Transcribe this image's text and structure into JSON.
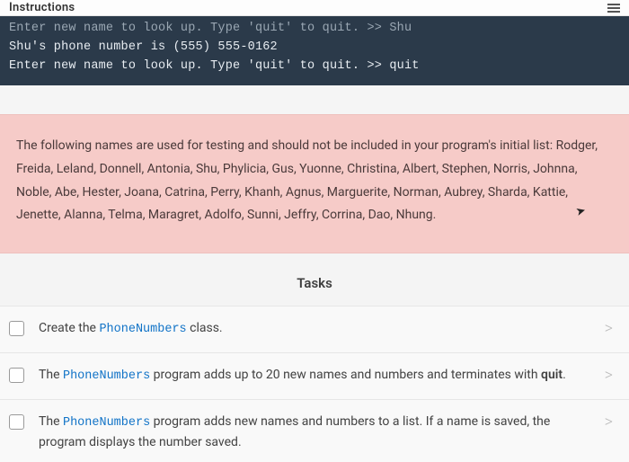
{
  "header": {
    "title_partial": "Instructions"
  },
  "terminal": {
    "line1_dim": "Enter new name to look up. Type 'quit' to quit. >> Shu",
    "line2": "Shu's phone number is (555) 555-0162",
    "line3": "Enter new name to look up. Type 'quit' to quit. >> quit"
  },
  "note": {
    "lead": "The following names are used for testing and should not be included in your program's initial list:",
    "names": "Rodger, Freida, Leland, Donnell, Antonia, Shu, Phylicia, Gus, Yuonne, Christina, Albert, Stephen, Norris, Johnna, Noble, Abe, Hester, Joana, Catrina, Perry, Khanh, Agnus, Marguerite, Norman, Aubrey, Sharda, Kattie, Jenette, Alanna, Telma, Maragret, Adolfo, Sunni, Jeffry, Corrina, Dao, Nhung."
  },
  "tasks": {
    "heading": "Tasks",
    "items": [
      {
        "pre": "Create the ",
        "code": "PhoneNumbers",
        "post": " class."
      },
      {
        "pre": "The ",
        "code": "PhoneNumbers",
        "post1": " program adds up to 20 new names and numbers and terminates with ",
        "bold": "quit",
        "post2": "."
      },
      {
        "pre": "The ",
        "code": "PhoneNumbers",
        "post": " program adds new names and numbers to a list. If a name is saved, the program displays the number saved."
      }
    ],
    "chevron": ">"
  }
}
